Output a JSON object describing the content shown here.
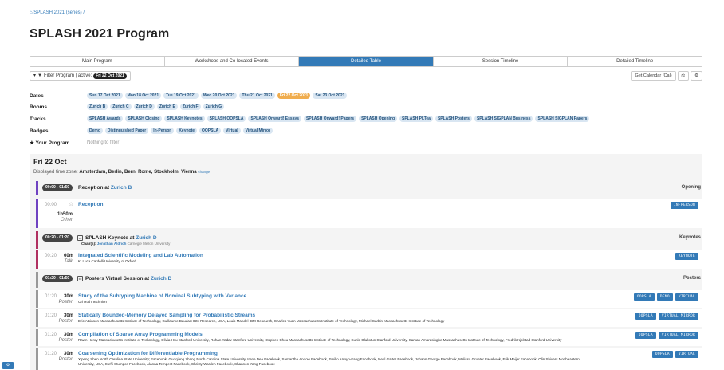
{
  "breadcrumb": {
    "icon": "home-icon",
    "text": "SPLASH 2021 (series) /"
  },
  "title": "SPLASH 2021 Program",
  "tabs": [
    "Main Program",
    "Workshops and Co-located Events",
    "Detailed Table",
    "Session Timeline",
    "Detailed Timeline"
  ],
  "active_tab": "Detailed Table",
  "filter": {
    "label": "Filter Program | active:",
    "active": "Fri 22 Oct 2021"
  },
  "toolbar": {
    "calendar": "Get Calendar (Cal)"
  },
  "filters": {
    "dates": {
      "label": "Dates",
      "items": [
        "Sun 17 Oct 2021",
        "Mon 18 Oct 2021",
        "Tue 19 Oct 2021",
        "Wed 20 Oct 2021",
        "Thu 21 Oct 2021",
        "Fri 22 Oct 2021",
        "Sat 23 Oct 2021"
      ]
    },
    "rooms": {
      "label": "Rooms",
      "items": [
        "Zurich B",
        "Zurich C",
        "Zurich D",
        "Zurich E",
        "Zurich F",
        "Zurich G"
      ]
    },
    "tracks": {
      "label": "Tracks",
      "items": [
        "SPLASH Awards",
        "SPLASH Closing",
        "SPLASH Keynotes",
        "SPLASH OOPSLA",
        "SPLASH Onward! Essays",
        "SPLASH Onward! Papers",
        "SPLASH Opening",
        "SPLASH PLTea",
        "SPLASH Posters",
        "SPLASH SIGPLAN Business",
        "SPLASH SIGPLAN Papers"
      ]
    },
    "badges": {
      "label": "Badges",
      "items": [
        "Demo",
        "Distinguished Paper",
        "In-Person",
        "Keynote",
        "OOPSLA",
        "Virtual",
        "Virtual Mirror"
      ]
    },
    "program": {
      "label": "★ Your Program",
      "value": "Nothing to filter"
    }
  },
  "day": {
    "title": "Fri 22 Oct",
    "tz_prefix": "Displayed time zone:",
    "tz": "Amsterdam, Berlin, Bern, Rome, Stockholm, Vienna",
    "tz_change": "change"
  },
  "sessions": [
    {
      "time": "00:00 - 01:50",
      "name": "Reception at",
      "room": "Zurich B",
      "type": "Opening",
      "color": "#6f42c1"
    },
    {
      "time": "00:20 - 01:20",
      "name": "SPLASH Keynote at",
      "room": "Zurich D",
      "type": "Keynotes",
      "color": "#b03060",
      "chair_label": "Chair(s):",
      "chair": "Jonathan Aldrich",
      "chair_aff": "Carnegie Mellon University"
    },
    {
      "time": "01:20 - 01:50",
      "name": "Posters Virtual Session at",
      "room": "Zurich D",
      "type": "Posters",
      "color": "#999999"
    }
  ],
  "events": [
    {
      "time": "00:00",
      "dur": "1h50m",
      "kind": "Other",
      "title": "Reception",
      "authors": "",
      "tags": [
        "In-Person"
      ]
    },
    {
      "time": "00:20",
      "dur": "60m",
      "kind": "Talk",
      "title": "Integrated Scientific Modeling and Lab Automation",
      "authors": "K: Luca Cardelli University of Oxford",
      "tags": [
        "Keynote"
      ]
    },
    {
      "time": "01:20",
      "dur": "30m",
      "kind": "Poster",
      "title": "Study of the Subtyping Machine of Nominal Subtyping with Variance",
      "authors": "Ori Roth Technion",
      "tags": [
        "OOPSLA",
        "Demo",
        "Virtual"
      ]
    },
    {
      "time": "01:20",
      "dur": "30m",
      "kind": "Poster",
      "title": "Statically Bounded-Memory Delayed Sampling for Probabilistic Streams",
      "authors": "Eric Atkinson Massachusetts Institute of Technology, Guillaume Baudart IBM Research, USA, Louis Mandel IBM Research, Charles Yuan Massachusetts Institute of Technology, Michael Carbin Massachusetts Institute of Technology",
      "tags": [
        "OOPSLA",
        "Virtual Mirror"
      ]
    },
    {
      "time": "01:20",
      "dur": "30m",
      "kind": "Poster",
      "title": "Compilation of Sparse Array Programming Models",
      "authors": "Rawn Henry Massachusetts Institute of Technology, Olivia Hsu Stanford University, Rohan Yadav Stanford University, Stephen Chou Massachusetts Institute of Technology, Kunle Olukotun Stanford University, Saman Amarasinghe Massachusetts Institute of Technology, Fredrik Kjolstad Stanford University",
      "tags": [
        "OOPSLA",
        "Virtual Mirror"
      ]
    },
    {
      "time": "01:20",
      "dur": "30m",
      "kind": "Poster",
      "title": "Coarsening Optimization for Differentiable Programming",
      "authors": "Xipeng Shen North Carolina State University; Facebook, Guoqiang Zhang North Carolina State University, Irene Dea Facebook, Samantha Andow Facebook, Emilio Arroyo-Fang Facebook, Neal Gafter Facebook, Johann George Facebook, Melissa Grueter Facebook, Erik Meijer Facebook, Olin Shivers Northeastern",
      "authors2": "University, USA, Steffi Stumpos Facebook, Alanna Tempest Facebook, Christy Warden Facebook, Shannon Yang Facebook",
      "tags": [
        "OOPSLA",
        "Virtual"
      ]
    }
  ]
}
